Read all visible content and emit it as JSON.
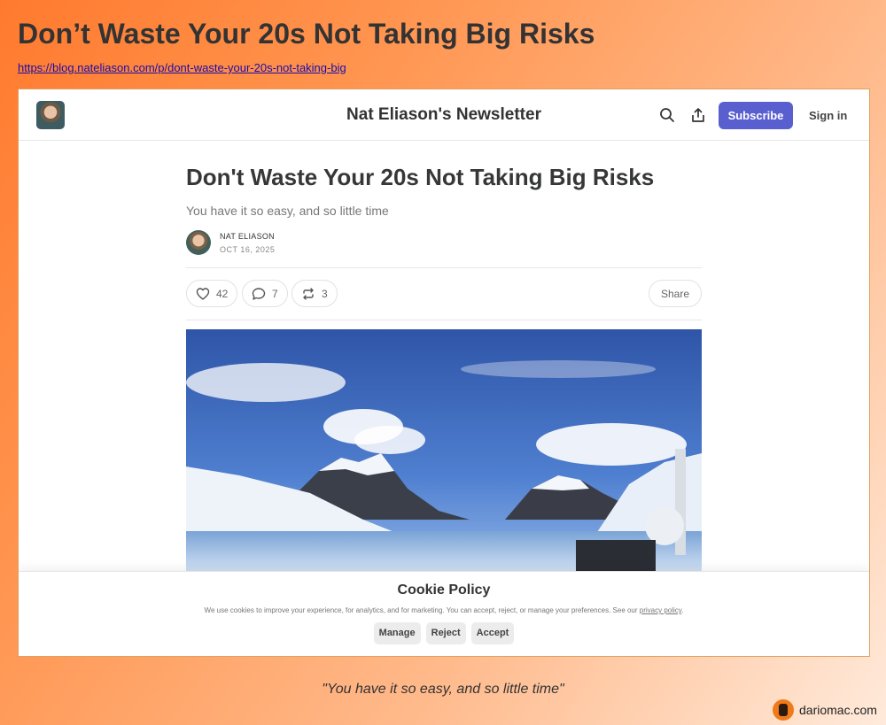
{
  "page": {
    "title": "Don’t Waste Your 20s Not Taking Big Risks",
    "url": "https://blog.nateliason.com/p/dont-waste-your-20s-not-taking-big",
    "caption": "\"You have it so easy, and so little time\"",
    "brand": "dariomac.com"
  },
  "topbar": {
    "publication": "Nat Eliason's Newsletter",
    "subscribe_label": "Subscribe",
    "signin_label": "Sign in"
  },
  "article": {
    "title": "Don't Waste Your 20s Not Taking Big Risks",
    "subtitle": "You have it so easy, and so little time",
    "author": "NAT ELIASON",
    "date": "OCT 16, 2025",
    "likes": "42",
    "comments": "7",
    "restacks": "3",
    "share_label": "Share"
  },
  "cookie": {
    "title": "Cookie Policy",
    "text": "We use cookies to improve your experience, for analytics, and for marketing. You can accept, reject, or manage your preferences. See our ",
    "link": "privacy policy",
    "period": ".",
    "manage_label": "Manage",
    "reject_label": "Reject",
    "accept_label": "Accept"
  },
  "colors": {
    "accent": "#5a5fcf",
    "background_start": "#ff7a2e",
    "background_end": "#ffeadb"
  }
}
